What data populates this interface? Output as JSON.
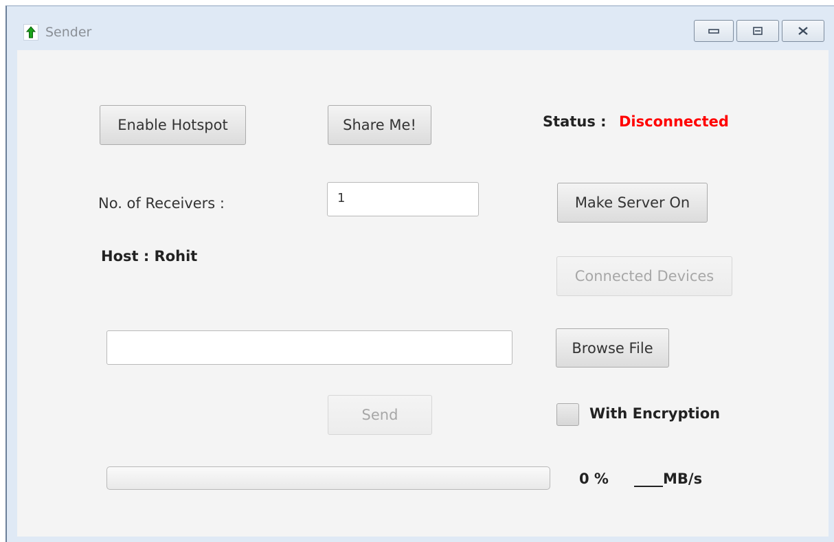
{
  "window": {
    "title": "Sender",
    "icon": "green-up-arrow-icon",
    "controls": [
      "minimize",
      "restore",
      "close"
    ]
  },
  "buttons": {
    "enable_hotspot": "Enable Hotspot",
    "share_me": "Share Me!",
    "make_server_on": "Make Server On",
    "connected_devices": "Connected Devices",
    "browse_file": "Browse File",
    "send": "Send"
  },
  "status": {
    "label": "Status :",
    "value": "Disconnected",
    "color": "#ff0000"
  },
  "receivers": {
    "label": "No. of Receivers :",
    "value": "1"
  },
  "host": {
    "text": "Host : Rohit"
  },
  "file_path": {
    "value": ""
  },
  "encryption": {
    "label": "With Encryption",
    "checked": false
  },
  "progress": {
    "value": 0,
    "percent_text": "0 %",
    "speed_text": "____MB/s"
  }
}
